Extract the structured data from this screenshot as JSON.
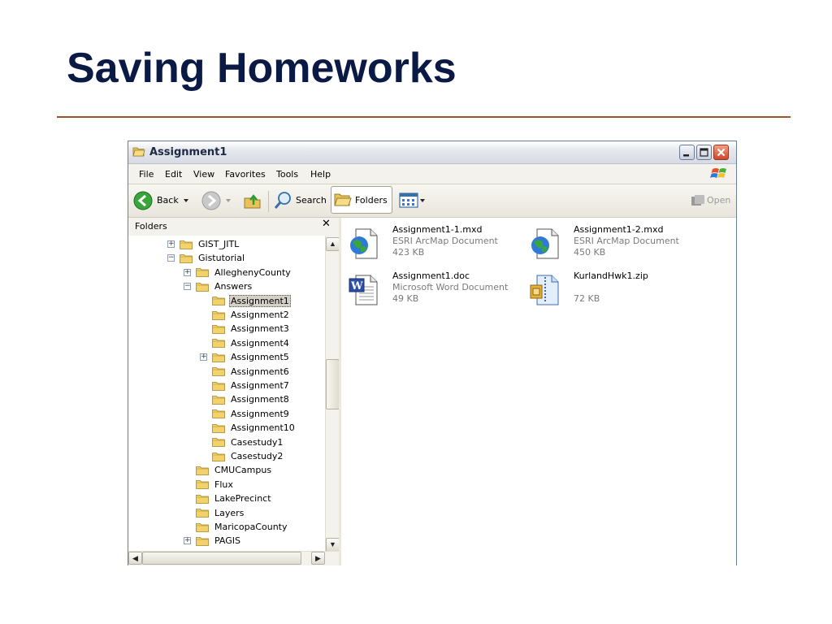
{
  "slide": {
    "title": "Saving Homeworks"
  },
  "window": {
    "title": "Assignment1",
    "controls": [
      "minimize",
      "maximize",
      "close"
    ]
  },
  "menu": [
    "File",
    "Edit",
    "View",
    "Favorites",
    "Tools",
    "Help"
  ],
  "toolbar": {
    "back_label": "Back",
    "search_label": "Search",
    "folders_label": "Folders",
    "open_label": "Open"
  },
  "folders_pane": {
    "title": "Folders",
    "close_glyph": "✕",
    "items": [
      {
        "label": "GIST_JITL",
        "level": 0,
        "expander": "+"
      },
      {
        "label": "Gistutorial",
        "level": 0,
        "expander": "-"
      },
      {
        "label": "AlleghenyCounty",
        "level": 1,
        "expander": "+"
      },
      {
        "label": "Answers",
        "level": 1,
        "expander": "-"
      },
      {
        "label": "Assignment1",
        "level": 2,
        "expander": "",
        "selected": true
      },
      {
        "label": "Assignment2",
        "level": 2,
        "expander": ""
      },
      {
        "label": "Assignment3",
        "level": 2,
        "expander": ""
      },
      {
        "label": "Assignment4",
        "level": 2,
        "expander": ""
      },
      {
        "label": "Assignment5",
        "level": 2,
        "expander": "+"
      },
      {
        "label": "Assignment6",
        "level": 2,
        "expander": ""
      },
      {
        "label": "Assignment7",
        "level": 2,
        "expander": ""
      },
      {
        "label": "Assignment8",
        "level": 2,
        "expander": ""
      },
      {
        "label": "Assignment9",
        "level": 2,
        "expander": ""
      },
      {
        "label": "Assignment10",
        "level": 2,
        "expander": ""
      },
      {
        "label": "Casestudy1",
        "level": 2,
        "expander": ""
      },
      {
        "label": "Casestudy2",
        "level": 2,
        "expander": ""
      },
      {
        "label": "CMUCampus",
        "level": 1,
        "expander": ""
      },
      {
        "label": "Flux",
        "level": 1,
        "expander": ""
      },
      {
        "label": "LakePrecinct",
        "level": 1,
        "expander": ""
      },
      {
        "label": "Layers",
        "level": 1,
        "expander": ""
      },
      {
        "label": "MaricopaCounty",
        "level": 1,
        "expander": ""
      },
      {
        "label": "PAGIS",
        "level": 1,
        "expander": "+"
      }
    ]
  },
  "files": [
    {
      "name": "Assignment1-1.mxd",
      "type": "ESRI ArcMap Document",
      "size": "423 KB",
      "icon": "arcmap-document-icon"
    },
    {
      "name": "Assignment1-2.mxd",
      "type": "ESRI ArcMap Document",
      "size": "450 KB",
      "icon": "arcmap-document-icon"
    },
    {
      "name": "Assignment1.doc",
      "type": "Microsoft Word Document",
      "size": "49 KB",
      "icon": "word-document-icon"
    },
    {
      "name": "KurlandHwk1.zip",
      "type": "",
      "size": "72 KB",
      "icon": "zip-archive-icon"
    }
  ]
}
